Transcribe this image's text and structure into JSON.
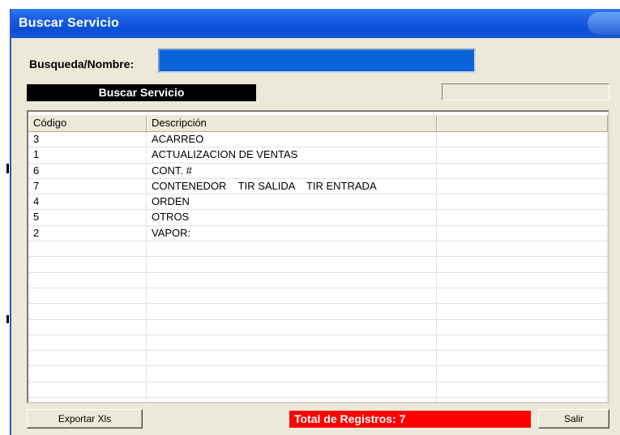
{
  "window": {
    "title": "Buscar Servicio"
  },
  "search": {
    "label": "Busqueda/Nombre:",
    "value": "",
    "button_label": "Buscar Servicio",
    "status_value": ""
  },
  "grid": {
    "columns": [
      "Código",
      "Descripción",
      ""
    ],
    "rows": [
      [
        "3",
        "ACARREO"
      ],
      [
        "1",
        "ACTUALIZACION DE VENTAS"
      ],
      [
        "6",
        "CONT. #"
      ],
      [
        "7",
        "CONTENEDOR    TIR SALIDA    TIR ENTRADA"
      ],
      [
        "4",
        "ORDEN"
      ],
      [
        "5",
        "OTROS"
      ],
      [
        "2",
        "VAPOR:"
      ],
      [
        "",
        ""
      ],
      [
        "",
        ""
      ],
      [
        "",
        ""
      ],
      [
        "",
        ""
      ],
      [
        "",
        ""
      ],
      [
        "",
        ""
      ],
      [
        "",
        ""
      ],
      [
        "",
        ""
      ],
      [
        "",
        ""
      ],
      [
        "",
        ""
      ],
      [
        "",
        ""
      ]
    ]
  },
  "footer": {
    "export_label": "Exportar Xls",
    "total_label": "Total de Registros: 7",
    "exit_label": "Salir"
  },
  "colors": {
    "titlebar": "#0a4fd8",
    "search_input": "#0a64d8",
    "total_badge": "#ff0000",
    "window_bg": "#ece9d8"
  }
}
